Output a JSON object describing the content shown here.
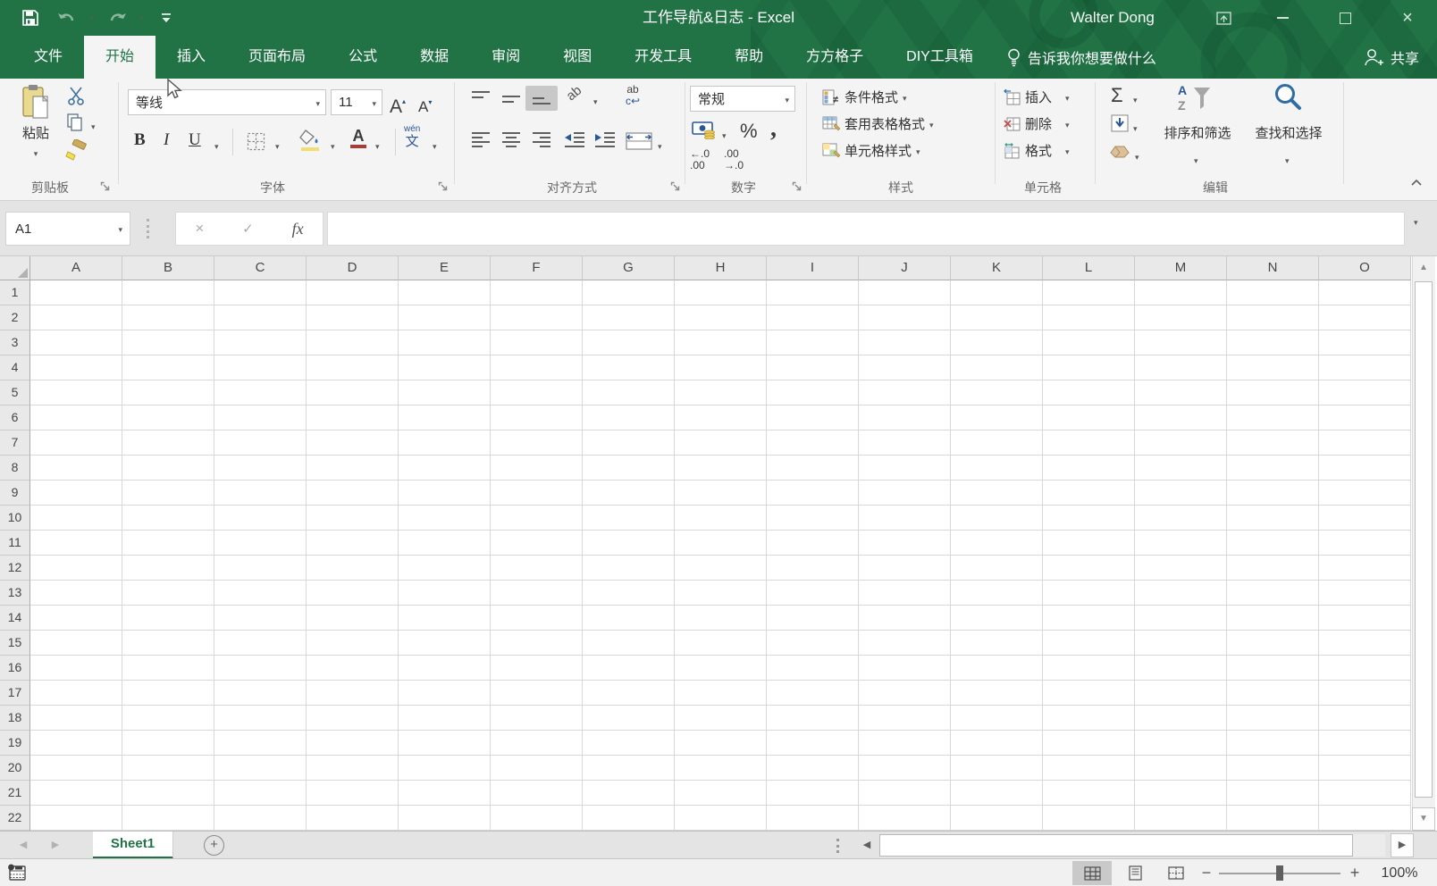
{
  "window": {
    "title": "工作导航&日志  -  Excel",
    "user": "Walter Dong"
  },
  "ribbon_tabs": {
    "file": "文件",
    "items": [
      {
        "label": "开始",
        "active": true
      },
      {
        "label": "插入"
      },
      {
        "label": "页面布局"
      },
      {
        "label": "公式"
      },
      {
        "label": "数据"
      },
      {
        "label": "审阅"
      },
      {
        "label": "视图"
      },
      {
        "label": "开发工具"
      },
      {
        "label": "帮助"
      },
      {
        "label": "方方格子"
      },
      {
        "label": "DIY工具箱"
      }
    ],
    "tell_me": "告诉我你想要做什么",
    "share": "共享"
  },
  "ribbon": {
    "clipboard": {
      "group": "剪贴板",
      "paste": "粘贴"
    },
    "font": {
      "group": "字体",
      "name": "等线",
      "size": "11",
      "bold": "B",
      "italic": "I",
      "underline": "U",
      "phonetic_top": "wén",
      "phonetic_bottom": "文"
    },
    "alignment": {
      "group": "对齐方式",
      "orient": "ab",
      "wrap_top": "ab",
      "wrap_bottom": "c↩"
    },
    "number": {
      "group": "数字",
      "format": "常规",
      "percent": "%",
      "comma": ",",
      "inc_dec_top": "←.0",
      "inc_dec_bottom": ".00",
      "dec_dec_top": ".00",
      "dec_dec_bottom": "→.0"
    },
    "styles": {
      "group": "样式",
      "conditional": "条件格式",
      "format_table": "套用表格格式",
      "cell_styles": "单元格样式"
    },
    "cells": {
      "group": "单元格",
      "insert": "插入",
      "delete": "删除",
      "format": "格式"
    },
    "editing": {
      "group": "编辑",
      "autosum": "Σ",
      "sort_filter": "排序和筛选",
      "find_select": "查找和选择",
      "az_top": "A",
      "az_bottom": "Z"
    },
    "collapse": "∧"
  },
  "formula_bar": {
    "name_box": "A1",
    "cancel": "×",
    "enter": "✓",
    "fx": "fx",
    "value": ""
  },
  "grid": {
    "columns": [
      "A",
      "B",
      "C",
      "D",
      "E",
      "F",
      "G",
      "H",
      "I",
      "J",
      "K",
      "L",
      "M",
      "N",
      "O"
    ],
    "rows": [
      "1",
      "2",
      "3",
      "4",
      "5",
      "6",
      "7",
      "8",
      "9",
      "10",
      "11",
      "12",
      "13",
      "14",
      "15",
      "16",
      "17",
      "18",
      "19",
      "20",
      "21",
      "22"
    ]
  },
  "sheet_bar": {
    "active_tab": "Sheet1"
  },
  "status_bar": {
    "zoom": "100%"
  }
}
